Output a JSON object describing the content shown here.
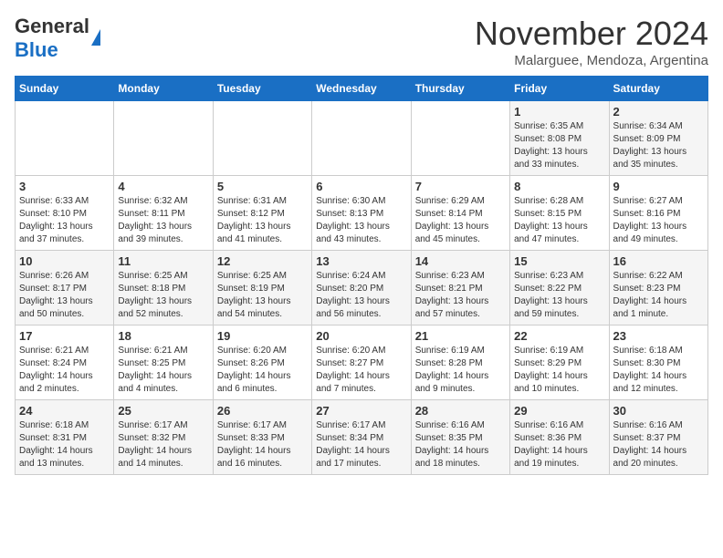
{
  "logo": {
    "general": "General",
    "blue": "Blue"
  },
  "header": {
    "month": "November 2024",
    "location": "Malarguee, Mendoza, Argentina"
  },
  "weekdays": [
    "Sunday",
    "Monday",
    "Tuesday",
    "Wednesday",
    "Thursday",
    "Friday",
    "Saturday"
  ],
  "weeks": [
    [
      {
        "day": "",
        "info": ""
      },
      {
        "day": "",
        "info": ""
      },
      {
        "day": "",
        "info": ""
      },
      {
        "day": "",
        "info": ""
      },
      {
        "day": "",
        "info": ""
      },
      {
        "day": "1",
        "info": "Sunrise: 6:35 AM\nSunset: 8:08 PM\nDaylight: 13 hours and 33 minutes."
      },
      {
        "day": "2",
        "info": "Sunrise: 6:34 AM\nSunset: 8:09 PM\nDaylight: 13 hours and 35 minutes."
      }
    ],
    [
      {
        "day": "3",
        "info": "Sunrise: 6:33 AM\nSunset: 8:10 PM\nDaylight: 13 hours and 37 minutes."
      },
      {
        "day": "4",
        "info": "Sunrise: 6:32 AM\nSunset: 8:11 PM\nDaylight: 13 hours and 39 minutes."
      },
      {
        "day": "5",
        "info": "Sunrise: 6:31 AM\nSunset: 8:12 PM\nDaylight: 13 hours and 41 minutes."
      },
      {
        "day": "6",
        "info": "Sunrise: 6:30 AM\nSunset: 8:13 PM\nDaylight: 13 hours and 43 minutes."
      },
      {
        "day": "7",
        "info": "Sunrise: 6:29 AM\nSunset: 8:14 PM\nDaylight: 13 hours and 45 minutes."
      },
      {
        "day": "8",
        "info": "Sunrise: 6:28 AM\nSunset: 8:15 PM\nDaylight: 13 hours and 47 minutes."
      },
      {
        "day": "9",
        "info": "Sunrise: 6:27 AM\nSunset: 8:16 PM\nDaylight: 13 hours and 49 minutes."
      }
    ],
    [
      {
        "day": "10",
        "info": "Sunrise: 6:26 AM\nSunset: 8:17 PM\nDaylight: 13 hours and 50 minutes."
      },
      {
        "day": "11",
        "info": "Sunrise: 6:25 AM\nSunset: 8:18 PM\nDaylight: 13 hours and 52 minutes."
      },
      {
        "day": "12",
        "info": "Sunrise: 6:25 AM\nSunset: 8:19 PM\nDaylight: 13 hours and 54 minutes."
      },
      {
        "day": "13",
        "info": "Sunrise: 6:24 AM\nSunset: 8:20 PM\nDaylight: 13 hours and 56 minutes."
      },
      {
        "day": "14",
        "info": "Sunrise: 6:23 AM\nSunset: 8:21 PM\nDaylight: 13 hours and 57 minutes."
      },
      {
        "day": "15",
        "info": "Sunrise: 6:23 AM\nSunset: 8:22 PM\nDaylight: 13 hours and 59 minutes."
      },
      {
        "day": "16",
        "info": "Sunrise: 6:22 AM\nSunset: 8:23 PM\nDaylight: 14 hours and 1 minute."
      }
    ],
    [
      {
        "day": "17",
        "info": "Sunrise: 6:21 AM\nSunset: 8:24 PM\nDaylight: 14 hours and 2 minutes."
      },
      {
        "day": "18",
        "info": "Sunrise: 6:21 AM\nSunset: 8:25 PM\nDaylight: 14 hours and 4 minutes."
      },
      {
        "day": "19",
        "info": "Sunrise: 6:20 AM\nSunset: 8:26 PM\nDaylight: 14 hours and 6 minutes."
      },
      {
        "day": "20",
        "info": "Sunrise: 6:20 AM\nSunset: 8:27 PM\nDaylight: 14 hours and 7 minutes."
      },
      {
        "day": "21",
        "info": "Sunrise: 6:19 AM\nSunset: 8:28 PM\nDaylight: 14 hours and 9 minutes."
      },
      {
        "day": "22",
        "info": "Sunrise: 6:19 AM\nSunset: 8:29 PM\nDaylight: 14 hours and 10 minutes."
      },
      {
        "day": "23",
        "info": "Sunrise: 6:18 AM\nSunset: 8:30 PM\nDaylight: 14 hours and 12 minutes."
      }
    ],
    [
      {
        "day": "24",
        "info": "Sunrise: 6:18 AM\nSunset: 8:31 PM\nDaylight: 14 hours and 13 minutes."
      },
      {
        "day": "25",
        "info": "Sunrise: 6:17 AM\nSunset: 8:32 PM\nDaylight: 14 hours and 14 minutes."
      },
      {
        "day": "26",
        "info": "Sunrise: 6:17 AM\nSunset: 8:33 PM\nDaylight: 14 hours and 16 minutes."
      },
      {
        "day": "27",
        "info": "Sunrise: 6:17 AM\nSunset: 8:34 PM\nDaylight: 14 hours and 17 minutes."
      },
      {
        "day": "28",
        "info": "Sunrise: 6:16 AM\nSunset: 8:35 PM\nDaylight: 14 hours and 18 minutes."
      },
      {
        "day": "29",
        "info": "Sunrise: 6:16 AM\nSunset: 8:36 PM\nDaylight: 14 hours and 19 minutes."
      },
      {
        "day": "30",
        "info": "Sunrise: 6:16 AM\nSunset: 8:37 PM\nDaylight: 14 hours and 20 minutes."
      }
    ]
  ]
}
